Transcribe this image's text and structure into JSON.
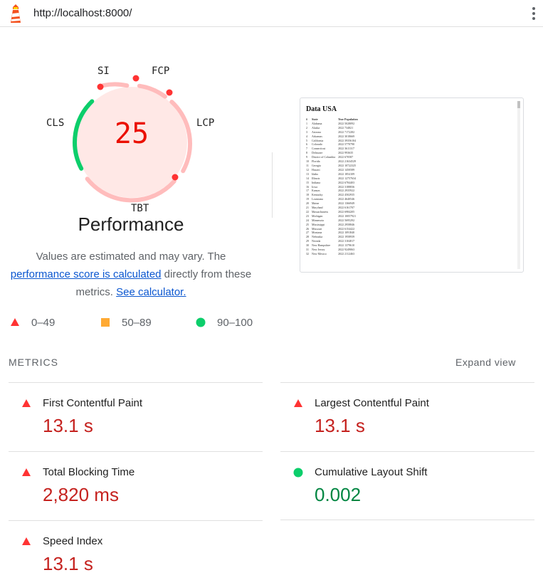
{
  "topbar": {
    "url": "http://localhost:8000/",
    "logo_icon": "lighthouse-icon",
    "menu_icon": "more-vert-icon"
  },
  "gauge": {
    "score": "25",
    "labels": {
      "si": "SI",
      "fcp": "FCP",
      "lcp": "LCP",
      "tbt": "TBT",
      "cls": "CLS"
    },
    "score_fraction": 0.25,
    "colors": {
      "fail": "#ff3333",
      "fail_text": "#eb0f00",
      "fail_bg": "#ffe8e6",
      "pass": "#0cce6b"
    }
  },
  "performance": {
    "title": "Performance",
    "desc_prefix": "Values are estimated and may vary. The ",
    "desc_link": "performance score is calculated",
    "desc_middle": " directly from these metrics. ",
    "desc_link2": "See calculator."
  },
  "legend": [
    {
      "icon": "triangle-fail-icon",
      "range": "0–49",
      "color": "#ff3333"
    },
    {
      "icon": "square-average-icon",
      "range": "50–89",
      "color": "#ffaa33"
    },
    {
      "icon": "circle-pass-icon",
      "range": "90–100",
      "color": "#0cce6b"
    }
  ],
  "thumbnail": {
    "title": "Data USA",
    "headers": [
      "#",
      "State",
      "Year Population"
    ],
    "rows": [
      [
        "1",
        "Alabama",
        "2022 5028092"
      ],
      [
        "2",
        "Alaska",
        "2022 734821"
      ],
      [
        "3",
        "Arizona",
        "2022 7172282"
      ],
      [
        "4",
        "Arkansas",
        "2022 3018669"
      ],
      [
        "5",
        "California",
        "2022 39356104"
      ],
      [
        "6",
        "Colorado",
        "2022 5770790"
      ],
      [
        "7",
        "Connecticut",
        "2022 3611317"
      ],
      [
        "8",
        "Delaware",
        "2022 993635"
      ],
      [
        "9",
        "District of Columbia",
        "2022 670587"
      ],
      [
        "10",
        "Florida",
        "2022 21634529"
      ],
      [
        "11",
        "Georgia",
        "2022 10722325"
      ],
      [
        "12",
        "Hawaii",
        "2022 1450589"
      ],
      [
        "13",
        "Idaho",
        "2022 1854109"
      ],
      [
        "14",
        "Illinois",
        "2022 12757634"
      ],
      [
        "15",
        "Indiana",
        "2022 6784403"
      ],
      [
        "16",
        "Iowa",
        "2022 3188836"
      ],
      [
        "17",
        "Kansas",
        "2022 2935922"
      ],
      [
        "18",
        "Kentucky",
        "2022 4502935"
      ],
      [
        "19",
        "Louisiana",
        "2022 4640546"
      ],
      [
        "20",
        "Maine",
        "2022 1366949"
      ],
      [
        "21",
        "Maryland",
        "2022 6161707"
      ],
      [
        "22",
        "Massachusetts",
        "2022 6984205"
      ],
      [
        "23",
        "Michigan",
        "2022 10057921"
      ],
      [
        "24",
        "Minnesota",
        "2022 5695292"
      ],
      [
        "25",
        "Mississippi",
        "2022 2958846"
      ],
      [
        "26",
        "Missouri",
        "2022 6154422"
      ],
      [
        "27",
        "Montana",
        "2022 1091840"
      ],
      [
        "28",
        "Nebraska",
        "2022 1958939"
      ],
      [
        "29",
        "Nevada",
        "2022 3104817"
      ],
      [
        "30",
        "New Hampshire",
        "2022 1379610"
      ],
      [
        "31",
        "New Jersey",
        "2022 9249063"
      ],
      [
        "32",
        "New Mexico",
        "2022 2112463"
      ]
    ]
  },
  "metrics": {
    "heading": "METRICS",
    "expand_label": "Expand view",
    "items": [
      {
        "name": "First Contentful Paint",
        "value": "13.1 s",
        "status": "fail"
      },
      {
        "name": "Largest Contentful Paint",
        "value": "13.1 s",
        "status": "fail"
      },
      {
        "name": "Total Blocking Time",
        "value": "2,820 ms",
        "status": "fail"
      },
      {
        "name": "Cumulative Layout Shift",
        "value": "0.002",
        "status": "pass"
      },
      {
        "name": "Speed Index",
        "value": "13.1 s",
        "status": "fail"
      }
    ]
  }
}
